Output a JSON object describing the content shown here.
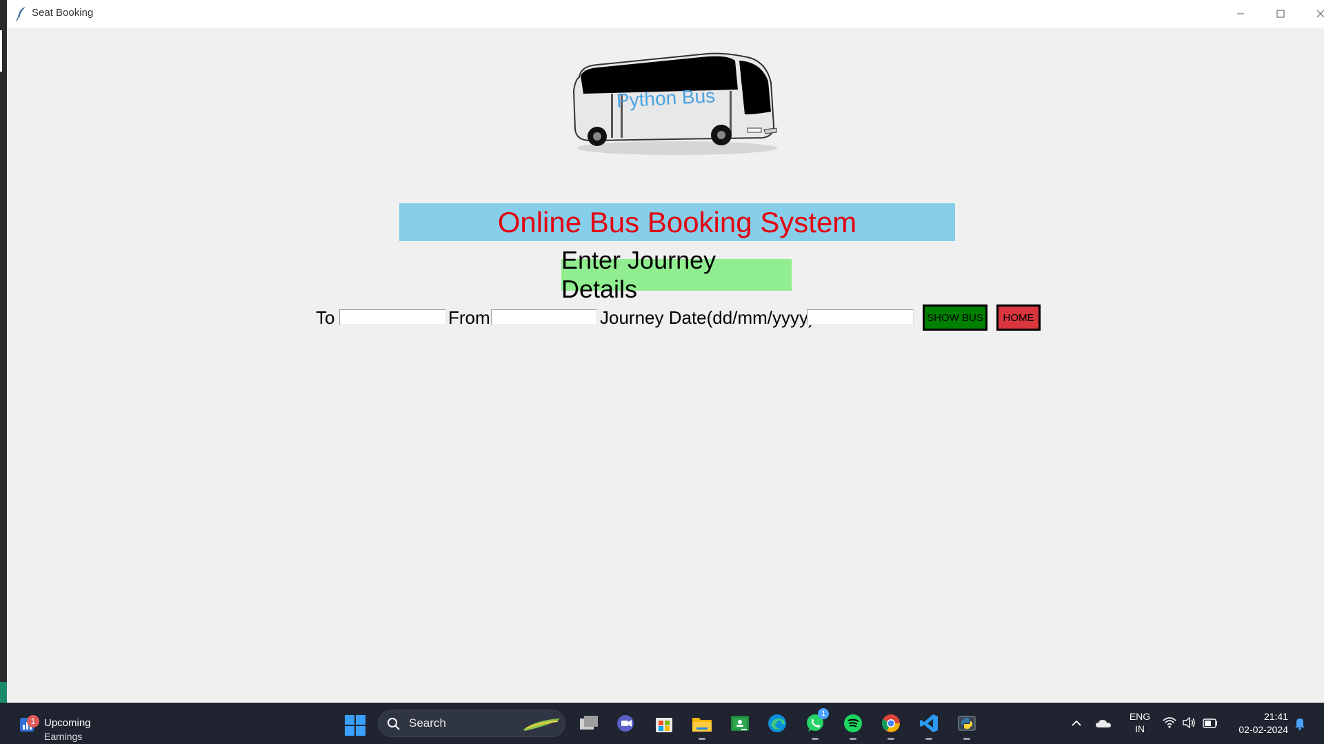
{
  "window": {
    "title": "Seat Booking"
  },
  "logo": {
    "text": "Python Bus"
  },
  "header": {
    "title": "Online Bus Booking System",
    "subtitle": "Enter Journey Details"
  },
  "form": {
    "to_label": "To",
    "to_value": "",
    "from_label": "From",
    "from_value": "",
    "date_label": "Journey Date(dd/mm/yyyy)",
    "date_value": "",
    "show_bus_label": "SHOW BUS",
    "home_label": "HOME"
  },
  "taskbar": {
    "widget_badge": "1",
    "widget_title": "Upcoming",
    "widget_subtitle": "Earnings",
    "search_placeholder": "Search",
    "apps": [
      {
        "name": "task-view-icon"
      },
      {
        "name": "teams-meet-icon"
      },
      {
        "name": "microsoft-store-icon"
      },
      {
        "name": "file-explorer-icon"
      },
      {
        "name": "google-classroom-icon"
      },
      {
        "name": "edge-browser-icon"
      },
      {
        "name": "whatsapp-icon",
        "badge": "1"
      },
      {
        "name": "spotify-icon"
      },
      {
        "name": "chrome-icon"
      },
      {
        "name": "vscode-icon"
      },
      {
        "name": "python-icon"
      }
    ],
    "lang_line1": "ENG",
    "lang_line2": "IN",
    "time": "21:41",
    "date": "02-02-2024"
  },
  "colors": {
    "banner_bg": "#87ceeb",
    "banner_text": "#e3000f",
    "subtitle_bg": "#90ee90",
    "show_bus_bg": "#008000",
    "home_bg": "#d9363e"
  }
}
